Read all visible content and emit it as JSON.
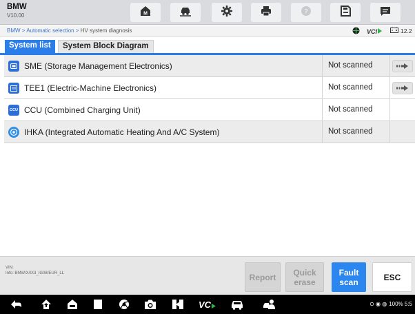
{
  "app": {
    "brand": "BMW",
    "version": "V10.00"
  },
  "toolbar": {
    "buttons": [
      {
        "name": "home-button",
        "icon": "home-m-icon"
      },
      {
        "name": "vehicle-swap-button",
        "icon": "vehicle-swap-icon"
      },
      {
        "name": "settings-button",
        "icon": "gear-icon"
      },
      {
        "name": "print-button",
        "icon": "printer-icon"
      },
      {
        "name": "help-button",
        "icon": "help-icon"
      },
      {
        "name": "save-button",
        "icon": "save-icon"
      },
      {
        "name": "message-button",
        "icon": "message-icon"
      }
    ]
  },
  "breadcrumb": {
    "path": "BMW > Automatic selection > ",
    "current": "HV system diagnosis"
  },
  "indicators": {
    "vci": "VCI",
    "battery": "12.2"
  },
  "tabs": {
    "system_list": "System list",
    "block_diagram": "System Block Diagram"
  },
  "systems": [
    {
      "name": "SME (Storage Management Electronics)",
      "status": "Not scanned",
      "icon": "sme-icon",
      "has_action": true
    },
    {
      "name": "TEE1 (Electric-Machine Electronics)",
      "status": "Not scanned",
      "icon": "tee-icon",
      "has_action": true
    },
    {
      "name": "CCU (Combined Charging Unit)",
      "status": "Not scanned",
      "icon": "ccu-icon",
      "icon_text": "CCU",
      "has_action": false
    },
    {
      "name": "IHKA (Integrated Automatic Heating And A/C System)",
      "status": "Not scanned",
      "icon": "ihka-icon",
      "has_action": false
    }
  ],
  "vehicle_info": {
    "vin_label": "VIN:",
    "info": "Info: BMW/X/IX3_/G08/EUR_LL"
  },
  "bottom_buttons": {
    "report": "Report",
    "quick_erase": "Quick erase",
    "fault_scan": "Fault scan",
    "esc": "ESC"
  },
  "status_bar": {
    "text": "100% 5:5"
  },
  "colors": {
    "accent": "#2b7de9",
    "primary_button": "#2b86ef",
    "vci_green": "#2fb44a"
  }
}
